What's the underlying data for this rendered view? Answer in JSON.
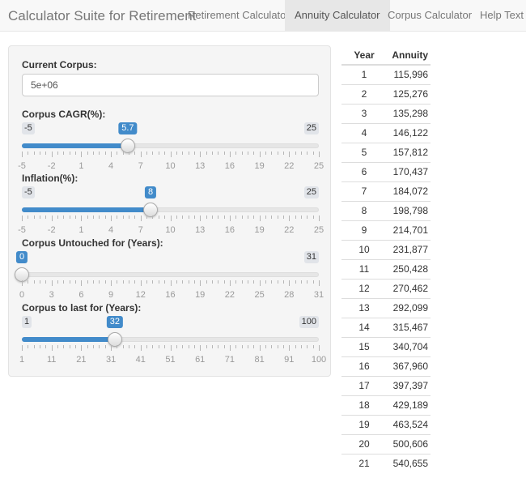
{
  "navbar": {
    "brand": "Calculator Suite for Retirement",
    "tabs": [
      {
        "label": "Retirement Calculator",
        "active": false
      },
      {
        "label": "Annuity Calculator",
        "active": true
      },
      {
        "label": "Corpus Calculator",
        "active": false
      },
      {
        "label": "Help Text",
        "active": false
      }
    ]
  },
  "form": {
    "current_corpus": {
      "label": "Current Corpus:",
      "value": "5e+06"
    },
    "sliders": [
      {
        "key": "cagr",
        "label": "Corpus CAGR(%):",
        "min": -5,
        "max": 25,
        "value": 5.7,
        "min_label": "-5",
        "max_label": "25",
        "value_label": "5.7",
        "ticks": [
          "-5",
          "-2",
          "1",
          "4",
          "7",
          "10",
          "13",
          "16",
          "19",
          "22",
          "25"
        ]
      },
      {
        "key": "inflation",
        "label": "Inflation(%):",
        "min": -5,
        "max": 25,
        "value": 8,
        "min_label": "-5",
        "max_label": "25",
        "value_label": "8",
        "ticks": [
          "-5",
          "-2",
          "1",
          "4",
          "7",
          "10",
          "13",
          "16",
          "19",
          "22",
          "25"
        ]
      },
      {
        "key": "untouched",
        "label": "Corpus Untouched for (Years):",
        "min": 0,
        "max": 31,
        "value": 0,
        "min_label": "",
        "max_label": "31",
        "value_label": "0",
        "ticks": [
          "0",
          "3",
          "6",
          "9",
          "12",
          "16",
          "19",
          "22",
          "25",
          "28",
          "31"
        ]
      },
      {
        "key": "last",
        "label": "Corpus to last for (Years):",
        "min": 1,
        "max": 100,
        "value": 32,
        "min_label": "1",
        "max_label": "100",
        "value_label": "32",
        "ticks": [
          "1",
          "11",
          "21",
          "31",
          "41",
          "51",
          "61",
          "71",
          "81",
          "91",
          "100"
        ]
      }
    ]
  },
  "table": {
    "headers": [
      "Year",
      "Annuity"
    ],
    "rows": [
      [
        "1",
        "115,996"
      ],
      [
        "2",
        "125,276"
      ],
      [
        "3",
        "135,298"
      ],
      [
        "4",
        "146,122"
      ],
      [
        "5",
        "157,812"
      ],
      [
        "6",
        "170,437"
      ],
      [
        "7",
        "184,072"
      ],
      [
        "8",
        "198,798"
      ],
      [
        "9",
        "214,701"
      ],
      [
        "10",
        "231,877"
      ],
      [
        "11",
        "250,428"
      ],
      [
        "12",
        "270,462"
      ],
      [
        "13",
        "292,099"
      ],
      [
        "14",
        "315,467"
      ],
      [
        "15",
        "340,704"
      ],
      [
        "16",
        "367,960"
      ],
      [
        "17",
        "397,397"
      ],
      [
        "18",
        "429,189"
      ],
      [
        "19",
        "463,524"
      ],
      [
        "20",
        "500,606"
      ],
      [
        "21",
        "540,655"
      ]
    ]
  },
  "colors": {
    "accent": "#428bca",
    "track": "#e6e6e6",
    "panel": "#f5f5f5",
    "navbar": "#f8f8f8"
  }
}
